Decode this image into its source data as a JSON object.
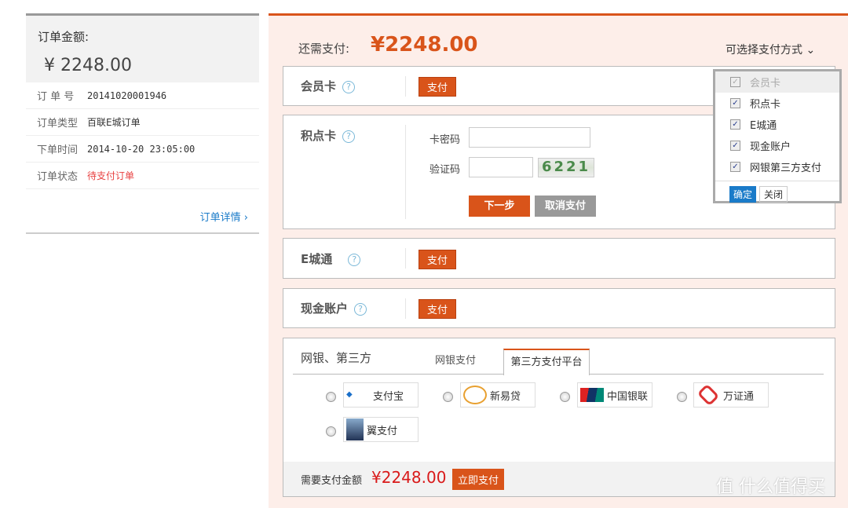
{
  "order": {
    "amount_label": "订单金额:",
    "amount": "¥ 2248.00",
    "rows": [
      {
        "k": "订 单 号",
        "v": "20141020001946"
      },
      {
        "k": "订单类型",
        "v": "百联E城订单"
      },
      {
        "k": "下单时间",
        "v": "2014-10-20 23:05:00"
      },
      {
        "k": "订单状态",
        "v": "待支付订单"
      }
    ],
    "detail_link": "订单详情 ›"
  },
  "pay": {
    "due_label": "还需支付:",
    "due_amount": "¥2248.00",
    "choose_label": "可选择支付方式 ⌄",
    "pay_label": "支付",
    "help": "?",
    "member_card": "会员卡",
    "points_card": "积点卡",
    "ecity": "E城通",
    "cash": "现金账户",
    "card_pwd_label": "卡密码",
    "captcha_label": "验证码",
    "captcha_text": "6221",
    "next": "下一步",
    "cancel": "取消支付",
    "bank_title": "网银、第三方",
    "tabs": [
      "网银支付",
      "第三方支付平台"
    ],
    "platforms": [
      "支付宝",
      "新易贷",
      "中国银联",
      "万证通",
      "翼支付"
    ],
    "footer_label": "需要支付金额",
    "footer_amount": "¥2248.00",
    "pay_now": "立即支付"
  },
  "dropdown": {
    "items": [
      {
        "label": "会员卡",
        "checked": true,
        "disabled": true
      },
      {
        "label": "积点卡",
        "checked": true
      },
      {
        "label": "E城通",
        "checked": true
      },
      {
        "label": "现金账户",
        "checked": true
      },
      {
        "label": "网银第三方支付",
        "checked": true
      }
    ],
    "ok": "确定",
    "close": "关闭"
  },
  "watermark": "值 什么值得买",
  "colors": {
    "accent": "#d9541a",
    "link": "#1a7bc9",
    "status": "#e84040"
  }
}
